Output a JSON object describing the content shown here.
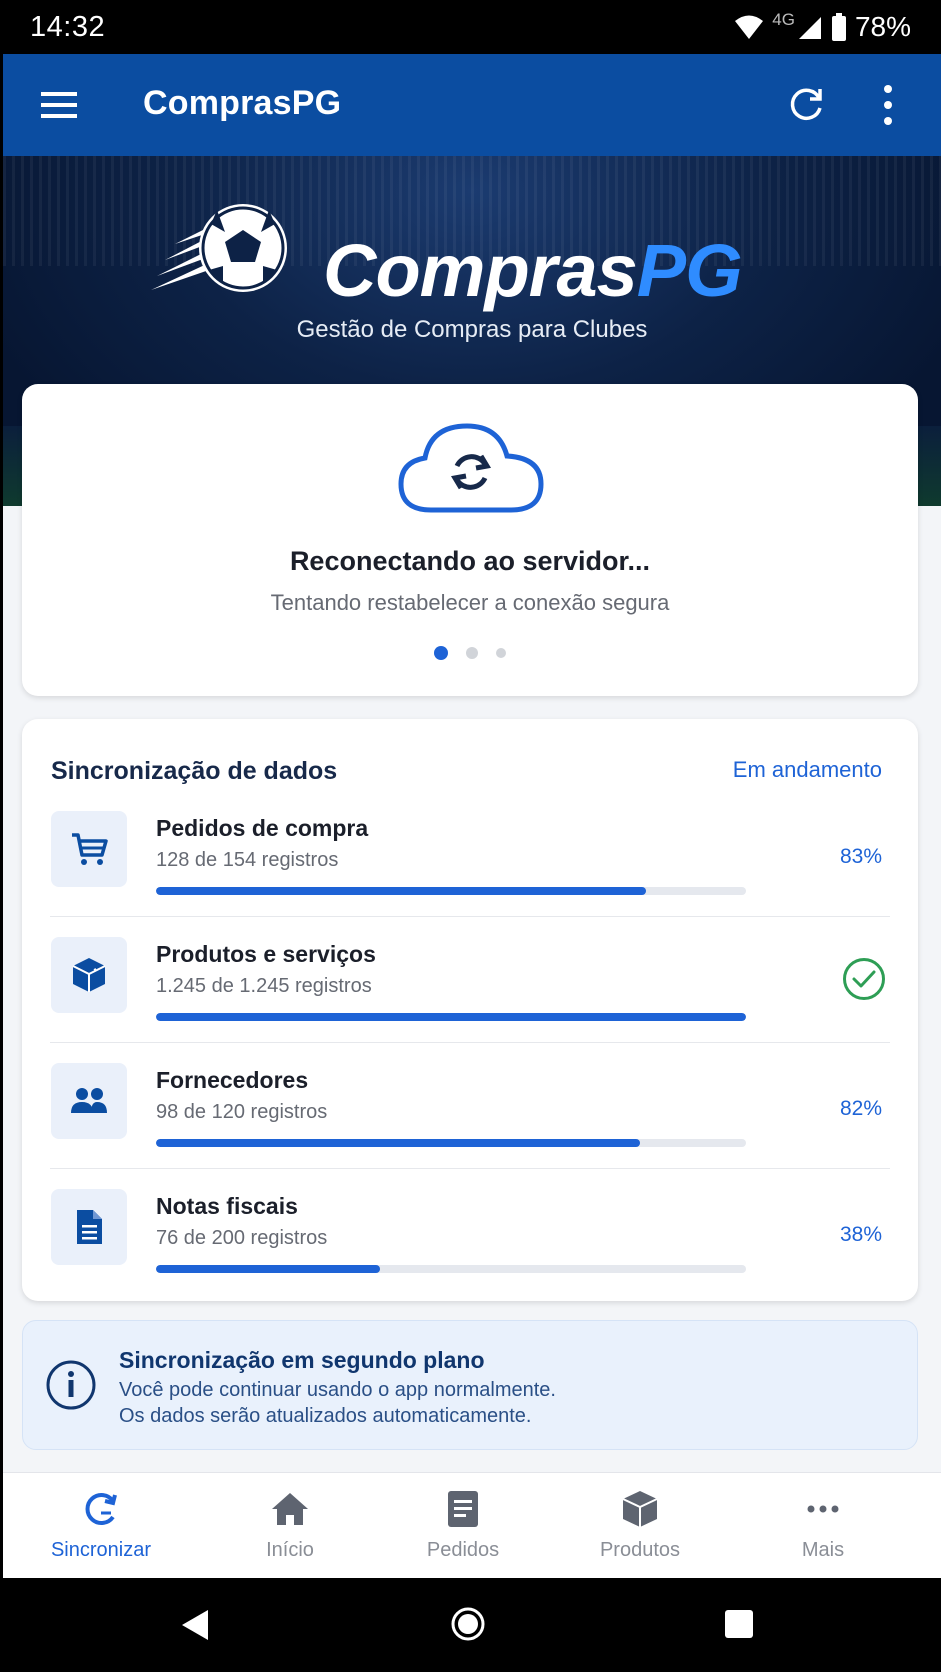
{
  "status_bar": {
    "time": "14:32",
    "network": "4G",
    "battery": "78%"
  },
  "app_bar": {
    "title": "ComprasPG"
  },
  "hero": {
    "brand_main": "Compras",
    "brand_accent": "PG",
    "subtitle": "Gestão de Compras para Clubes"
  },
  "reconnect": {
    "title": "Reconectando ao servidor...",
    "subtitle": "Tentando restabelecer a conexão segura",
    "active_page": 1,
    "pages": 3
  },
  "sync": {
    "title": "Sincronização de dados",
    "status": "Em andamento",
    "rows": [
      {
        "icon": "cart-icon",
        "title": "Pedidos de compra",
        "count": "128 de 154 registros",
        "pct": "83%",
        "progress": 0.83,
        "done": false
      },
      {
        "icon": "box-icon",
        "title": "Produtos e serviços",
        "count": "1.245 de 1.245 registros",
        "pct": "",
        "progress": 1.0,
        "done": true
      },
      {
        "icon": "people-icon",
        "title": "Fornecedores",
        "count": "98 de 120 registros",
        "pct": "82%",
        "progress": 0.82,
        "done": false
      },
      {
        "icon": "document-icon",
        "title": "Notas fiscais",
        "count": "76 de 200 registros",
        "pct": "38%",
        "progress": 0.38,
        "done": false
      }
    ]
  },
  "info": {
    "title": "Sincronização em segundo plano",
    "line1": "Você pode continuar usando o app normalmente.",
    "line2": "Os dados serão atualizados automaticamente."
  },
  "bottom_nav": {
    "items": [
      {
        "label": "Sincronizar",
        "icon": "sync-icon",
        "active": true
      },
      {
        "label": "Início",
        "icon": "home-icon",
        "active": false
      },
      {
        "label": "Pedidos",
        "icon": "orders-icon",
        "active": false
      },
      {
        "label": "Produtos",
        "icon": "products-icon",
        "active": false
      },
      {
        "label": "Mais",
        "icon": "more-horizontal-icon",
        "active": false
      }
    ]
  },
  "colors": {
    "primary": "#0b4da1",
    "accent": "#1e63d6",
    "success": "#2e9e55"
  }
}
